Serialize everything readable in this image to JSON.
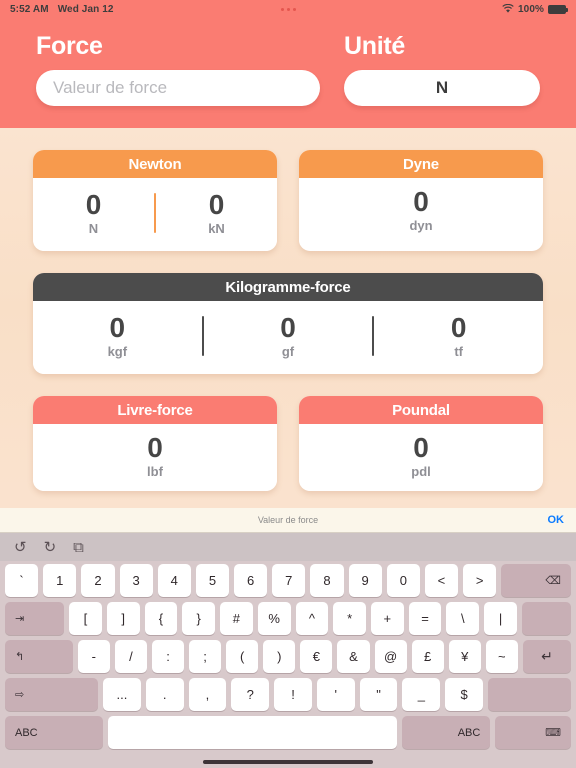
{
  "status_bar": {
    "time": "5:52 AM",
    "date": "Wed Jan 12",
    "battery_percent": "100%",
    "wifi_icon": "wifi-icon",
    "battery_icon": "battery-icon",
    "multitask_dots": "multitask-dots-icon"
  },
  "header": {
    "force_label": "Force",
    "force_placeholder": "Valeur de force",
    "force_value": "",
    "unit_label": "Unité",
    "unit_value": "N",
    "background_color": "#fa7c72"
  },
  "results": [
    {
      "title": "Newton",
      "header_color": "#f79a4d",
      "divider_color": "#f79a4d",
      "cells": [
        {
          "value": "0",
          "unit": "N"
        },
        {
          "value": "0",
          "unit": "kN"
        }
      ]
    },
    {
      "title": "Dyne",
      "header_color": "#f79a4d",
      "divider_color": "#f79a4d",
      "cells": [
        {
          "value": "0",
          "unit": "dyn"
        }
      ]
    },
    {
      "title": "Kilogramme-force",
      "header_color": "#4c4c4c",
      "divider_color": "#4c4c4c",
      "cells": [
        {
          "value": "0",
          "unit": "kgf"
        },
        {
          "value": "0",
          "unit": "gf"
        },
        {
          "value": "0",
          "unit": "tf"
        }
      ]
    },
    {
      "title": "Livre-force",
      "header_color": "#fa7c72",
      "divider_color": "#fa7c72",
      "cells": [
        {
          "value": "0",
          "unit": "lbf"
        }
      ]
    },
    {
      "title": "Poundal",
      "header_color": "#fa7c72",
      "divider_color": "#fa7c72",
      "cells": [
        {
          "value": "0",
          "unit": "pdl"
        }
      ]
    }
  ],
  "keyboard": {
    "accessory_title": "Valeur de force",
    "ok_label": "OK",
    "tools": [
      {
        "name": "undo-icon",
        "glyph": "↺"
      },
      {
        "name": "redo-icon",
        "glyph": "↻"
      },
      {
        "name": "paste-icon",
        "glyph": "⧉"
      }
    ],
    "rows": [
      [
        {
          "label": "`"
        },
        {
          "label": "1"
        },
        {
          "label": "2"
        },
        {
          "label": "3"
        },
        {
          "label": "4"
        },
        {
          "label": "5"
        },
        {
          "label": "6"
        },
        {
          "label": "7"
        },
        {
          "label": "8"
        },
        {
          "label": "9"
        },
        {
          "label": "0"
        },
        {
          "label": "<"
        },
        {
          "label": ">"
        },
        {
          "label": "⌫",
          "name": "backspace-key"
        }
      ],
      [
        {
          "label": "⇥",
          "name": "tab-key"
        },
        {
          "label": "["
        },
        {
          "label": "]"
        },
        {
          "label": "{"
        },
        {
          "label": "}"
        },
        {
          "label": "#"
        },
        {
          "label": "%"
        },
        {
          "label": "^"
        },
        {
          "label": "*"
        },
        {
          "label": "+"
        },
        {
          "label": "="
        },
        {
          "label": "\\"
        },
        {
          "label": "|"
        },
        {
          "label": "",
          "name": "blank-key"
        }
      ],
      [
        {
          "label": "↰",
          "name": "capslock-key"
        },
        {
          "label": "-"
        },
        {
          "label": "/"
        },
        {
          "label": ":"
        },
        {
          "label": ";"
        },
        {
          "label": "("
        },
        {
          "label": ")"
        },
        {
          "label": "€"
        },
        {
          "label": "&"
        },
        {
          "label": "@"
        },
        {
          "label": "£"
        },
        {
          "label": "¥"
        },
        {
          "label": "~"
        },
        {
          "label": "↵",
          "name": "return-key"
        }
      ],
      [
        {
          "label": "⇨",
          "name": "shift-left-key"
        },
        {
          "label": "..."
        },
        {
          "label": "."
        },
        {
          "label": ","
        },
        {
          "label": "?"
        },
        {
          "label": "!"
        },
        {
          "label": "'"
        },
        {
          "label": "\""
        },
        {
          "label": "_"
        },
        {
          "label": "$"
        },
        {
          "label": "",
          "name": "shift-right-key"
        }
      ],
      [
        {
          "label": "ABC",
          "name": "abc-left-key"
        },
        {
          "label": "",
          "name": "space-key"
        },
        {
          "label": "ABC",
          "name": "abc-right-key"
        },
        {
          "label": "⌨",
          "name": "dismiss-keyboard-key"
        }
      ]
    ]
  }
}
